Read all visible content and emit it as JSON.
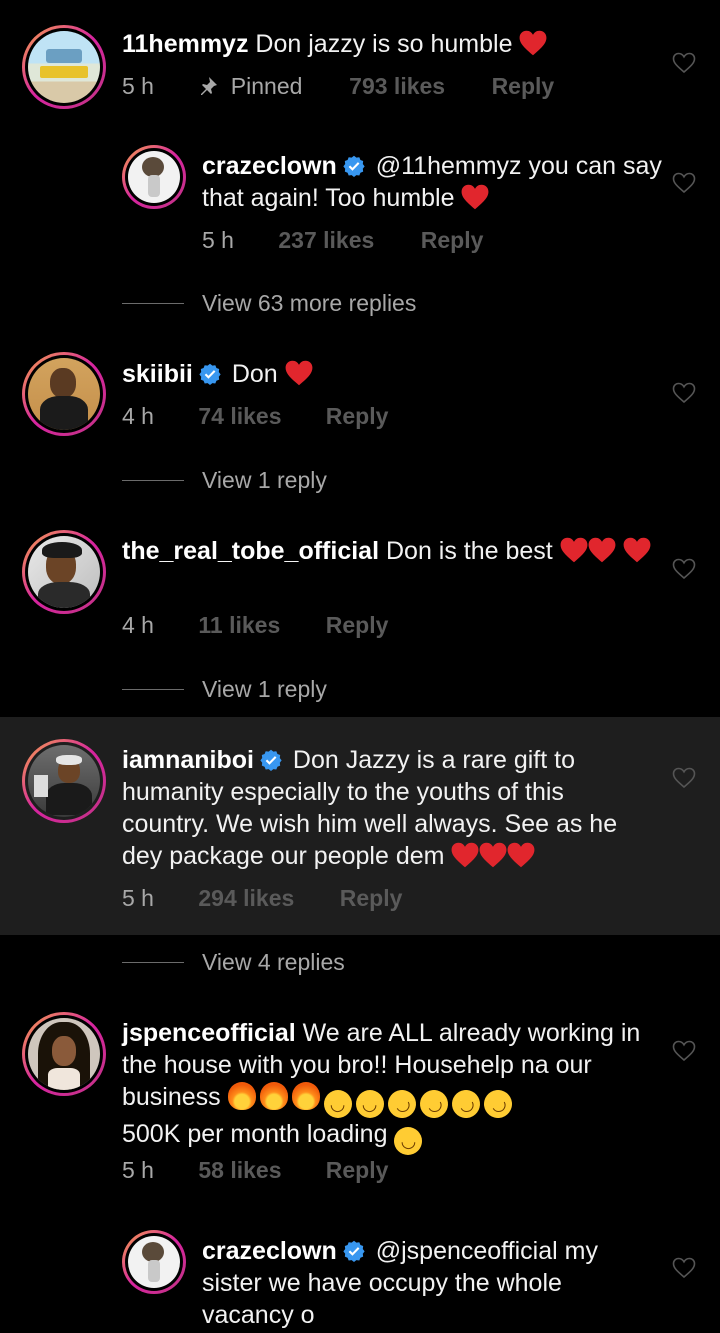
{
  "comments": [
    {
      "username": "11hemmyz",
      "text": "Don jazzy is so humble",
      "time": "5 h",
      "pinned": "Pinned",
      "likes": "793 likes",
      "reply": "Reply"
    },
    {
      "username": "crazeclown",
      "text": "@11hemmyz you can say that again! Too humble",
      "time": "5 h",
      "likes": "237 likes",
      "reply": "Reply"
    },
    {
      "view_replies": "View 63 more replies"
    },
    {
      "username": "skiibii",
      "text": "Don",
      "time": "4 h",
      "likes": "74 likes",
      "reply": "Reply"
    },
    {
      "view_replies": "View 1 reply"
    },
    {
      "username": "the_real_tobe_official",
      "text": "Don is the best",
      "time": "4 h",
      "likes": "11 likes",
      "reply": "Reply"
    },
    {
      "view_replies": "View 1 reply"
    },
    {
      "username": "iamnaniboi",
      "text": "Don Jazzy is a rare gift to humanity especially to the youths of this country. We wish him well always. See as he dey package our people dem",
      "time": "5 h",
      "likes": "294 likes",
      "reply": "Reply"
    },
    {
      "view_replies": "View 4 replies"
    },
    {
      "username": "jspenceofficial",
      "text": "We are ALL already working in the house with you bro!! Househelp na our business",
      "text2": "500K per month loading",
      "time": "5 h",
      "likes": "58 likes",
      "reply": "Reply"
    },
    {
      "username": "crazeclown",
      "text": "@jspenceofficial my sister we have occupy the whole vacancy o"
    }
  ],
  "colors": {
    "heart": "#e1262d",
    "verified": "#3897f0",
    "background": "#000000",
    "highlight": "#1e1e1e"
  },
  "icons": {
    "like": "heart-outline-icon",
    "pin": "pin-icon",
    "verified": "verified-badge-icon"
  }
}
